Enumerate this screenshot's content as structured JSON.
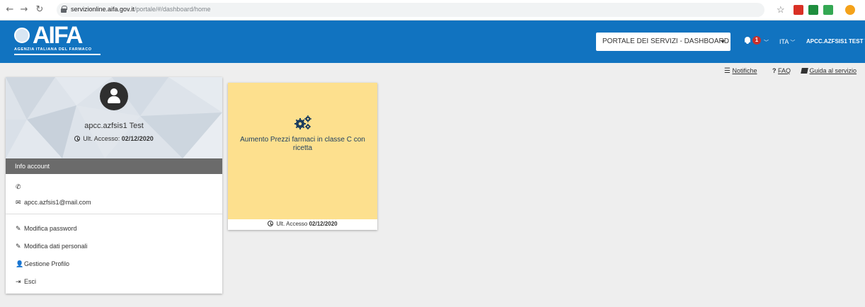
{
  "browser": {
    "url_host": "servizionline.aifa.gov.it",
    "url_path": "/portale/#/dashboard/home",
    "back_icon": "back-arrow-icon",
    "forward_icon": "forward-arrow-icon",
    "reload_icon": "reload-icon",
    "extension_colors": [
      "#d93025",
      "#1e8e3e",
      "#34a853",
      "#f4a21a"
    ]
  },
  "header": {
    "logo_word": "AIFA",
    "logo_subtitle": "AGENZIA ITALIANA DEL FARMACO",
    "portal_select": "PORTALE DEI SERVIZI - DASHBOARD",
    "notifications_count": "1",
    "language": "ITA",
    "user_menu": "APCC.AZFSIS1 TEST",
    "brand_color": "#1173c0"
  },
  "sublinks": {
    "notifiche": "Notifiche",
    "faq": "FAQ",
    "guida": "Guida al servizio"
  },
  "profile": {
    "username": "apcc.azfsis1 Test",
    "last_access_label": "Ult. Accesso:",
    "last_access_date": "02/12/2020",
    "info_title": "Info account",
    "phone": "",
    "email": "apcc.azfsis1@mail.com",
    "actions": {
      "password": "Modifica password",
      "personal": "Modifica dati personali",
      "profile": "Gestione Profilo",
      "logout": "Esci"
    }
  },
  "tile": {
    "title": "Aumento Prezzi farmaci in classe C con ricetta",
    "last_access_label": "Ult. Accesso",
    "last_access_date": "02/12/2020",
    "color": "#fde08e"
  }
}
